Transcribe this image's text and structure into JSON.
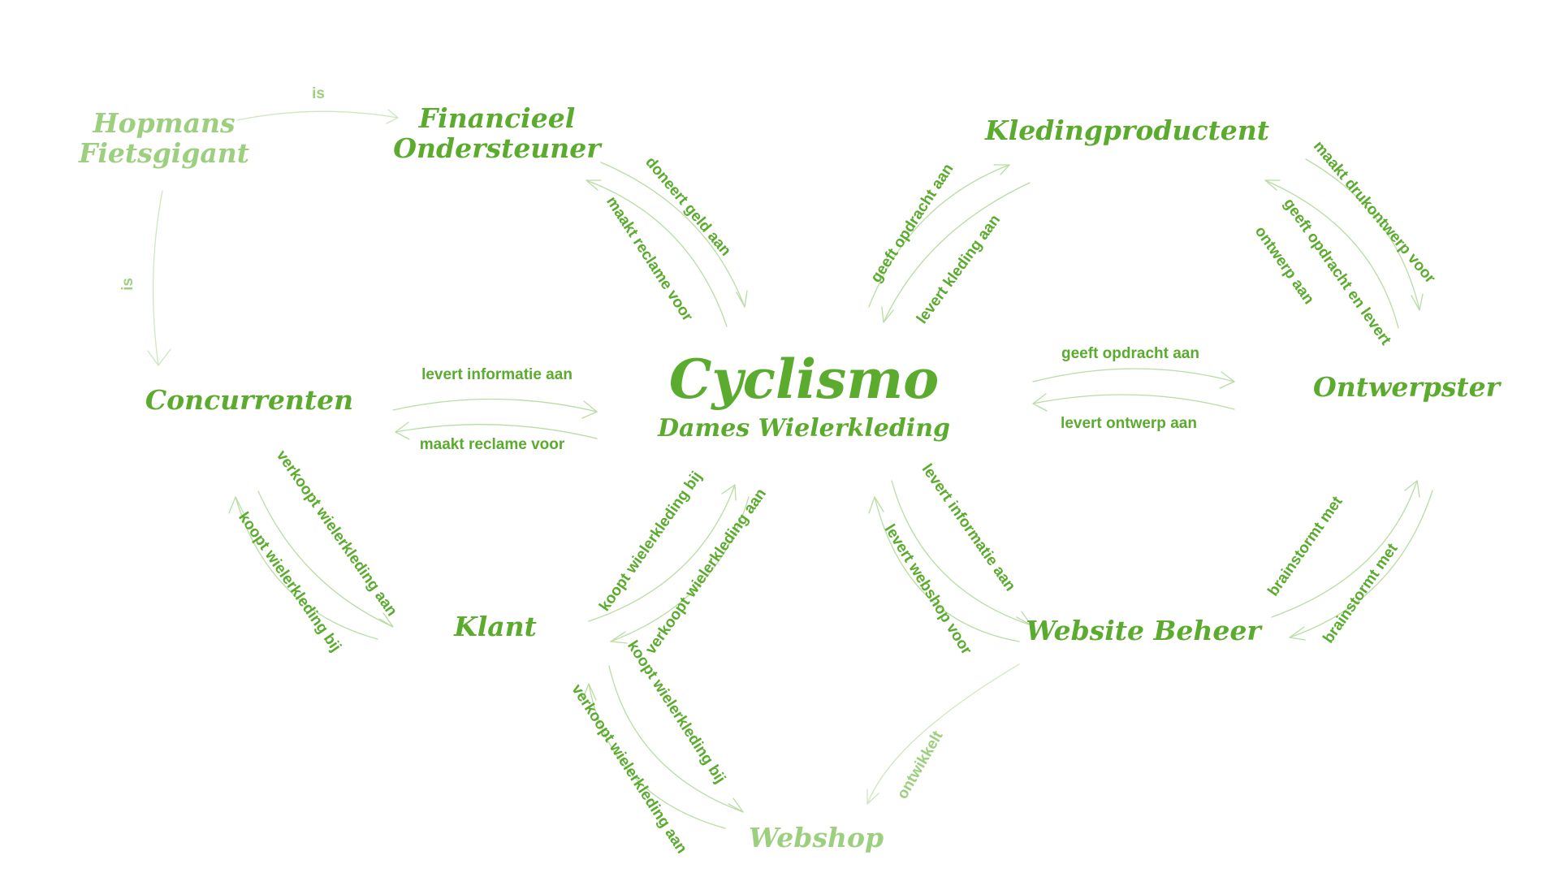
{
  "colors": {
    "primary": "#5aab2e",
    "light": "#9ccf7e",
    "line": "#b9dca4",
    "line_light": "#cfe6c1"
  },
  "nodes": {
    "cyclismo_title": "Cyclismo",
    "cyclismo_subtitle": "Dames Wielerkleding",
    "hopmans_line1": "Hopmans",
    "hopmans_line2": "Fietsgigant",
    "financieel_line1": "Financieel",
    "financieel_line2": "Ondersteuner",
    "kledingproducent": "Kledingproductent",
    "ontwerpster": "Ontwerpster",
    "concurrenten": "Concurrenten",
    "klant": "Klant",
    "website_beheer": "Website Beheer",
    "webshop": "Webshop"
  },
  "edges": {
    "hopmans_is_financieel": "is",
    "hopmans_is_concurrenten": "is",
    "financieel_doneert": "doneert geld aan",
    "cyclismo_reclame_financieel": "maakt reclame voor",
    "cyclismo_opdracht_kleding": "geeft opdracht aan",
    "kleding_levert": "levert kleding aan",
    "kleding_drukontwerp": "maakt drukontwerp voor",
    "ontwerpster_opdracht_line1": "geeft opdracht en levert",
    "ontwerpster_opdracht_line2": "ontwerp aan",
    "cyclismo_opdracht_ontwerpster": "geeft opdracht aan",
    "ontwerpster_levert_ontwerp": "levert ontwerp aan",
    "concurrenten_levert_info": "levert informatie aan",
    "cyclismo_reclame_concurrenten": "maakt reclame voor",
    "concurrenten_verkoopt": "verkoopt wielerkleding aan",
    "klant_koopt_concurrenten": "koopt wielerkleding bij",
    "klant_koopt_cyclismo": "koopt wielerkleding bij",
    "cyclismo_verkoopt_klant": "verkoopt wielerkleding aan",
    "cyclismo_levert_info_website": "levert informatie aan",
    "website_levert_webshop": "levert webshop voor",
    "website_brainstormt": "brainstormt met",
    "ontwerpster_brainstormt": "brainstormt met",
    "klant_koopt_webshop": "koopt wielerkleding bij",
    "webshop_verkoopt": "verkoopt wielerkleding aan",
    "website_ontwikkelt": "ontwikkelt"
  }
}
